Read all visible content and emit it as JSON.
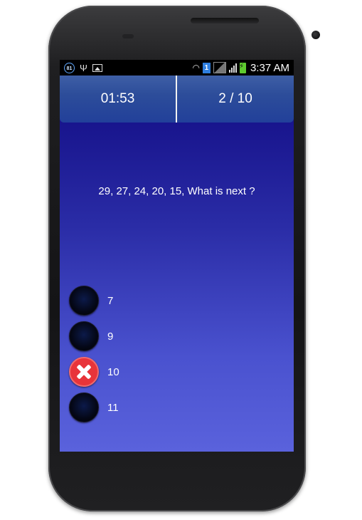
{
  "status_bar": {
    "notification_count": "81",
    "sim_slot": "1",
    "time": "3:37 AM"
  },
  "header": {
    "timer": "01:53",
    "progress": "2 / 10"
  },
  "question": {
    "text": "29, 27, 24, 20, 15, What is next ?"
  },
  "options": [
    {
      "label": "7",
      "state": "unselected"
    },
    {
      "label": "9",
      "state": "unselected"
    },
    {
      "label": "10",
      "state": "wrong"
    },
    {
      "label": "11",
      "state": "unselected"
    }
  ],
  "colors": {
    "background_top": "#100a82",
    "background_bottom": "#5a62dc",
    "header": "#2d4d9a",
    "wrong": "#e8343a"
  }
}
